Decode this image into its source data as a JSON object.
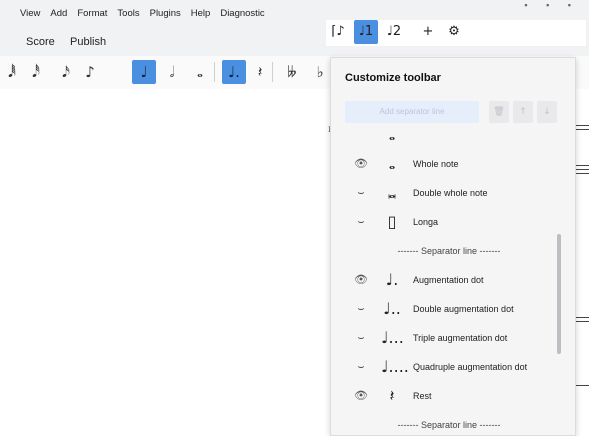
{
  "menu": [
    "View",
    "Add",
    "Format",
    "Tools",
    "Plugins",
    "Help",
    "Diagnostic"
  ],
  "tabs": [
    {
      "label": "Score",
      "active": true
    },
    {
      "label": "Publish",
      "active": false
    }
  ],
  "note_toolbar": {
    "buttons": [
      {
        "icon": "sixtyfourth-note-icon",
        "glyph": "𝅘𝅥𝅱"
      },
      {
        "icon": "thirtysecond-note-icon",
        "glyph": "𝅘𝅥𝅰"
      },
      {
        "icon": "sixteenth-note-icon",
        "glyph": "𝅘𝅥𝅯"
      },
      {
        "icon": "eighth-note-icon",
        "glyph": "♪"
      },
      {
        "icon": "quarter-note-icon",
        "glyph": "♩",
        "active": true
      },
      {
        "icon": "half-note-icon",
        "glyph": "𝅗𝅥"
      },
      {
        "icon": "whole-note-icon",
        "glyph": "𝅝"
      },
      {
        "icon": "augmentation-dot-icon",
        "glyph": "♩.",
        "active": true
      },
      {
        "icon": "rest-icon",
        "glyph": "𝄽"
      },
      {
        "icon": "double-flat-icon",
        "glyph": "𝄫"
      },
      {
        "icon": "flat-icon",
        "glyph": "♭"
      }
    ]
  },
  "workspace_bar": {
    "buttons": [
      {
        "icon": "voice-tie-icon",
        "glyph": "⌈♪"
      },
      {
        "icon": "voice-1-icon",
        "glyph": "♩1",
        "active": true
      },
      {
        "icon": "voice-2-icon",
        "glyph": "♩2"
      },
      {
        "icon": "plus-icon",
        "glyph": "+"
      },
      {
        "icon": "gear-icon",
        "glyph": "⚙"
      }
    ]
  },
  "popup": {
    "title": "Customize toolbar",
    "add_separator_label": "Add separator line",
    "items": [
      {
        "visible": "",
        "glyph": "𝅝",
        "label": ""
      },
      {
        "visible": "eye",
        "glyph": "𝅝",
        "label": "Whole note"
      },
      {
        "visible": "hidden",
        "glyph": "𝅜",
        "label": "Double whole note"
      },
      {
        "visible": "hidden",
        "glyph": "▯",
        "label": "Longa"
      },
      {
        "separator": true,
        "label": "------- Separator line -------"
      },
      {
        "visible": "eye",
        "glyph": "♩.",
        "label": "Augmentation dot"
      },
      {
        "visible": "hidden",
        "glyph": "♩..",
        "label": "Double augmentation dot"
      },
      {
        "visible": "hidden",
        "glyph": "♩...",
        "label": "Triple augmentation dot"
      },
      {
        "visible": "hidden",
        "glyph": "♩....",
        "label": "Quadruple augmentation dot"
      },
      {
        "visible": "eye",
        "glyph": "𝄽",
        "label": "Rest"
      },
      {
        "separator": true,
        "label": "------- Separator line -------"
      }
    ]
  },
  "colors": {
    "accent": "#4b8fe0",
    "tab_underline": "#2a7ad6"
  }
}
